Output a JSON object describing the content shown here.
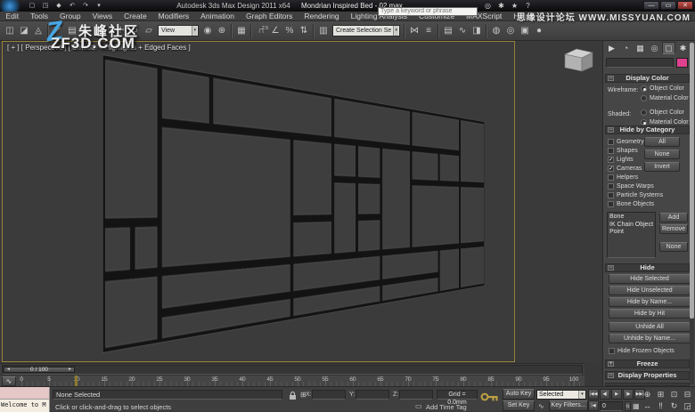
{
  "window": {
    "app_title": "Autodesk 3ds Max Design 2011 x64",
    "file_title": "Mondrian Inspired Bed - 02.max",
    "search_placeholder": "Type a keyword or phrase",
    "buttons": [
      {
        "n": "minimize",
        "g": "—"
      },
      {
        "n": "maximize",
        "g": "▭"
      },
      {
        "n": "close",
        "g": "✕"
      }
    ]
  },
  "quick_access": [
    {
      "n": "new-scene",
      "g": "▢"
    },
    {
      "n": "open-file",
      "g": "◳"
    },
    {
      "n": "save-file",
      "g": "◆"
    },
    {
      "n": "undo",
      "g": "↶"
    },
    {
      "n": "redo",
      "g": "↷"
    },
    {
      "n": "project-folder",
      "g": "▾"
    }
  ],
  "infocenter": [
    {
      "n": "search-go",
      "g": "◎"
    },
    {
      "n": "communication-center",
      "g": "✱"
    },
    {
      "n": "favorites",
      "g": "★"
    },
    {
      "n": "help",
      "g": "?"
    }
  ],
  "menu_items": [
    "Edit",
    "Tools",
    "Group",
    "Views",
    "Create",
    "Modifiers",
    "Animation",
    "Graph Editors",
    "Rendering",
    "Lighting Analysis",
    "Customize",
    "MAXScript",
    "Help"
  ],
  "watermarks": {
    "missyuan": "思缘设计论坛 WWW.MISSYUAN.COM",
    "z_logo": "Z",
    "zhufeng": "朱峰社区",
    "zf3d": "ZF3D.COM"
  },
  "toolbar": {
    "items": [
      {
        "n": "select-and-link",
        "g": "◫"
      },
      {
        "n": "unlink-selection",
        "g": "◪"
      },
      {
        "n": "bind-to-space-warp",
        "g": "◬"
      },
      {
        "sep": true
      },
      {
        "n": "select-object",
        "g": "◤"
      },
      {
        "n": "select-by-name",
        "g": "▤"
      },
      {
        "n": "rectangular-selection-region",
        "g": "▢"
      },
      {
        "n": "window-crossing-toggle",
        "g": "▣"
      },
      {
        "sep": true
      },
      {
        "n": "select-and-move",
        "g": "✚"
      },
      {
        "n": "select-and-rotate",
        "g": "↻"
      },
      {
        "n": "select-and-scale",
        "g": "▱"
      },
      {
        "dd": true,
        "n": "reference-coordinate-system",
        "label": "View",
        "w": 46
      },
      {
        "n": "use-pivot-point-center",
        "g": "◉"
      },
      {
        "n": "select-and-manipulate",
        "g": "⊕"
      },
      {
        "sep": true
      },
      {
        "n": "keyboard-shortcut-override",
        "g": "▦"
      },
      {
        "sep": true
      },
      {
        "n": "snaps-toggle",
        "g": "∩",
        "sup": "2.5"
      },
      {
        "n": "angle-snap",
        "g": "∠"
      },
      {
        "n": "percent-snap",
        "g": "%"
      },
      {
        "n": "spinner-snap",
        "g": "⇅"
      },
      {
        "sep": true
      },
      {
        "n": "edit-named-selection-sets",
        "g": "▥"
      },
      {
        "dd": true,
        "n": "named-selection-sets",
        "label": "Create Selection Se",
        "w": 76
      },
      {
        "sep": true
      },
      {
        "n": "mirror",
        "g": "⋈"
      },
      {
        "n": "align",
        "g": "≡"
      },
      {
        "sep": true
      },
      {
        "n": "layer-manager",
        "g": "▤"
      },
      {
        "n": "curve-editor",
        "g": "∿"
      },
      {
        "n": "schematic-view",
        "g": "◨"
      },
      {
        "sep": true
      },
      {
        "n": "material-editor",
        "g": "◍"
      },
      {
        "n": "render-setup",
        "g": "◎"
      },
      {
        "n": "rendered-frame-window",
        "g": "▣"
      },
      {
        "n": "render-production",
        "g": "●"
      }
    ]
  },
  "viewport": {
    "label": "[ + ] [ Perspective ] [ Smooth + Highlights + Edged Faces ]",
    "frame_color": "#131313",
    "face_color": "#3e3e3e",
    "panel_cells": [
      [
        0,
        0,
        120,
        190
      ],
      [
        0,
        190,
        61,
        60
      ],
      [
        61,
        190,
        59,
        60
      ],
      [
        0,
        250,
        120,
        86
      ],
      [
        120,
        0,
        124,
        70
      ],
      [
        244,
        0,
        375,
        70
      ],
      [
        619,
        0,
        330,
        70
      ],
      [
        949,
        0,
        259,
        70
      ],
      [
        1208,
        0,
        152,
        130
      ],
      [
        120,
        70,
        357,
        180
      ],
      [
        120,
        250,
        357,
        50
      ],
      [
        120,
        300,
        357,
        36
      ],
      [
        477,
        70,
        142,
        120
      ],
      [
        477,
        190,
        142,
        60
      ],
      [
        619,
        70,
        92,
        60
      ],
      [
        711,
        70,
        101,
        60
      ],
      [
        619,
        130,
        92,
        120
      ],
      [
        711,
        130,
        101,
        60
      ],
      [
        711,
        190,
        101,
        60
      ],
      [
        812,
        70,
        137,
        180
      ],
      [
        949,
        70,
        142,
        60
      ],
      [
        1091,
        70,
        117,
        60
      ],
      [
        949,
        130,
        259,
        120
      ],
      [
        1208,
        130,
        152,
        120
      ],
      [
        477,
        250,
        335,
        50
      ],
      [
        477,
        300,
        335,
        36
      ],
      [
        812,
        250,
        279,
        50
      ],
      [
        812,
        300,
        279,
        36
      ],
      [
        1091,
        250,
        117,
        86
      ],
      [
        1208,
        250,
        152,
        86
      ]
    ]
  },
  "command_panel": {
    "tabs": [
      {
        "n": "create",
        "g": "▶"
      },
      {
        "n": "modify",
        "g": "◔"
      },
      {
        "n": "hierarchy",
        "g": "▦"
      },
      {
        "n": "motion",
        "g": "◎"
      },
      {
        "n": "display",
        "g": "▢"
      },
      {
        "n": "utilities",
        "g": "✱"
      }
    ],
    "active_tab": "display",
    "object_color": "#e0418e",
    "rollouts": {
      "display_color": {
        "toggle": "−",
        "title": "Display Color",
        "wireframe_label": "Wireframe:",
        "shaded_label": "Shaded:",
        "object_color_label": "Object Color",
        "material_color_label": "Material Color",
        "wireframe_selected": "object",
        "shaded_selected": "material"
      },
      "hide_by_category": {
        "toggle": "−",
        "title": "Hide by Category",
        "categories": [
          {
            "label": "Geometry",
            "checked": false
          },
          {
            "label": "Shapes",
            "checked": false
          },
          {
            "label": "Lights",
            "checked": true
          },
          {
            "label": "Cameras",
            "checked": true
          },
          {
            "label": "Helpers",
            "checked": false
          },
          {
            "label": "Space Warps",
            "checked": false
          },
          {
            "label": "Particle Systems",
            "checked": false
          },
          {
            "label": "Bone Objects",
            "checked": false
          }
        ],
        "buttons": [
          "All",
          "None",
          "Invert"
        ],
        "list_items": [
          "Bone",
          "IK Chain Object",
          "Point"
        ],
        "list_buttons": [
          "Add",
          "Remove",
          "None"
        ]
      },
      "hide": {
        "toggle": "−",
        "title": "Hide",
        "buttons": [
          "Hide Selected",
          "Hide Unselected",
          "Hide by Name...",
          "Hide by Hit",
          "Unhide All",
          "Unhide by Name..."
        ],
        "checkbox": {
          "label": "Hide Frozen Objects",
          "checked": false
        }
      },
      "freeze": {
        "toggle": "+",
        "title": "Freeze"
      },
      "display_properties": {
        "toggle": "−",
        "title": "Display Properties"
      }
    }
  },
  "timeline": {
    "slider_label": "0 / 100",
    "ruler_min": 0,
    "ruler_max": 100,
    "ruler_step": 5
  },
  "status": {
    "macro_text": "",
    "listener_text": "Welcome to M",
    "selection": "None Selected",
    "prompt": "Click or click-and-drag to select objects",
    "x_label": "X:",
    "y_label": "Y:",
    "z_label": "Z:",
    "x_value": "",
    "y_value": "",
    "z_value": "",
    "grid_label": "Grid = 0.0mm",
    "add_time_tag": "Add Time Tag",
    "auto_key": "Auto Key",
    "set_key": "Set Key",
    "key_mode": "Selected",
    "key_filters": "Key Filters...",
    "frame": "0"
  },
  "icons": {
    "dropdown_arrow": "▾",
    "left_arrow": "◄",
    "right_arrow": "►",
    "check": "✓",
    "playback": [
      {
        "n": "go-to-start",
        "g": "|◀◀"
      },
      {
        "n": "previous-frame",
        "g": "◀|"
      },
      {
        "n": "play",
        "g": "▶"
      },
      {
        "n": "next-frame",
        "g": "|▶"
      },
      {
        "n": "go-to-end",
        "g": "▶▶|"
      }
    ],
    "nav_row1": [
      {
        "n": "zoom",
        "g": "⊕"
      },
      {
        "n": "zoom-all",
        "g": "⊞"
      },
      {
        "n": "zoom-extents",
        "g": "⊡"
      },
      {
        "n": "zoom-region",
        "g": "⊟"
      }
    ],
    "nav_row2": [
      {
        "n": "pan",
        "g": "↔"
      },
      {
        "n": "walk-through",
        "g": "‼"
      },
      {
        "n": "orbit",
        "g": "↻"
      },
      {
        "n": "maximize-viewport-toggle",
        "g": "◲"
      }
    ]
  }
}
